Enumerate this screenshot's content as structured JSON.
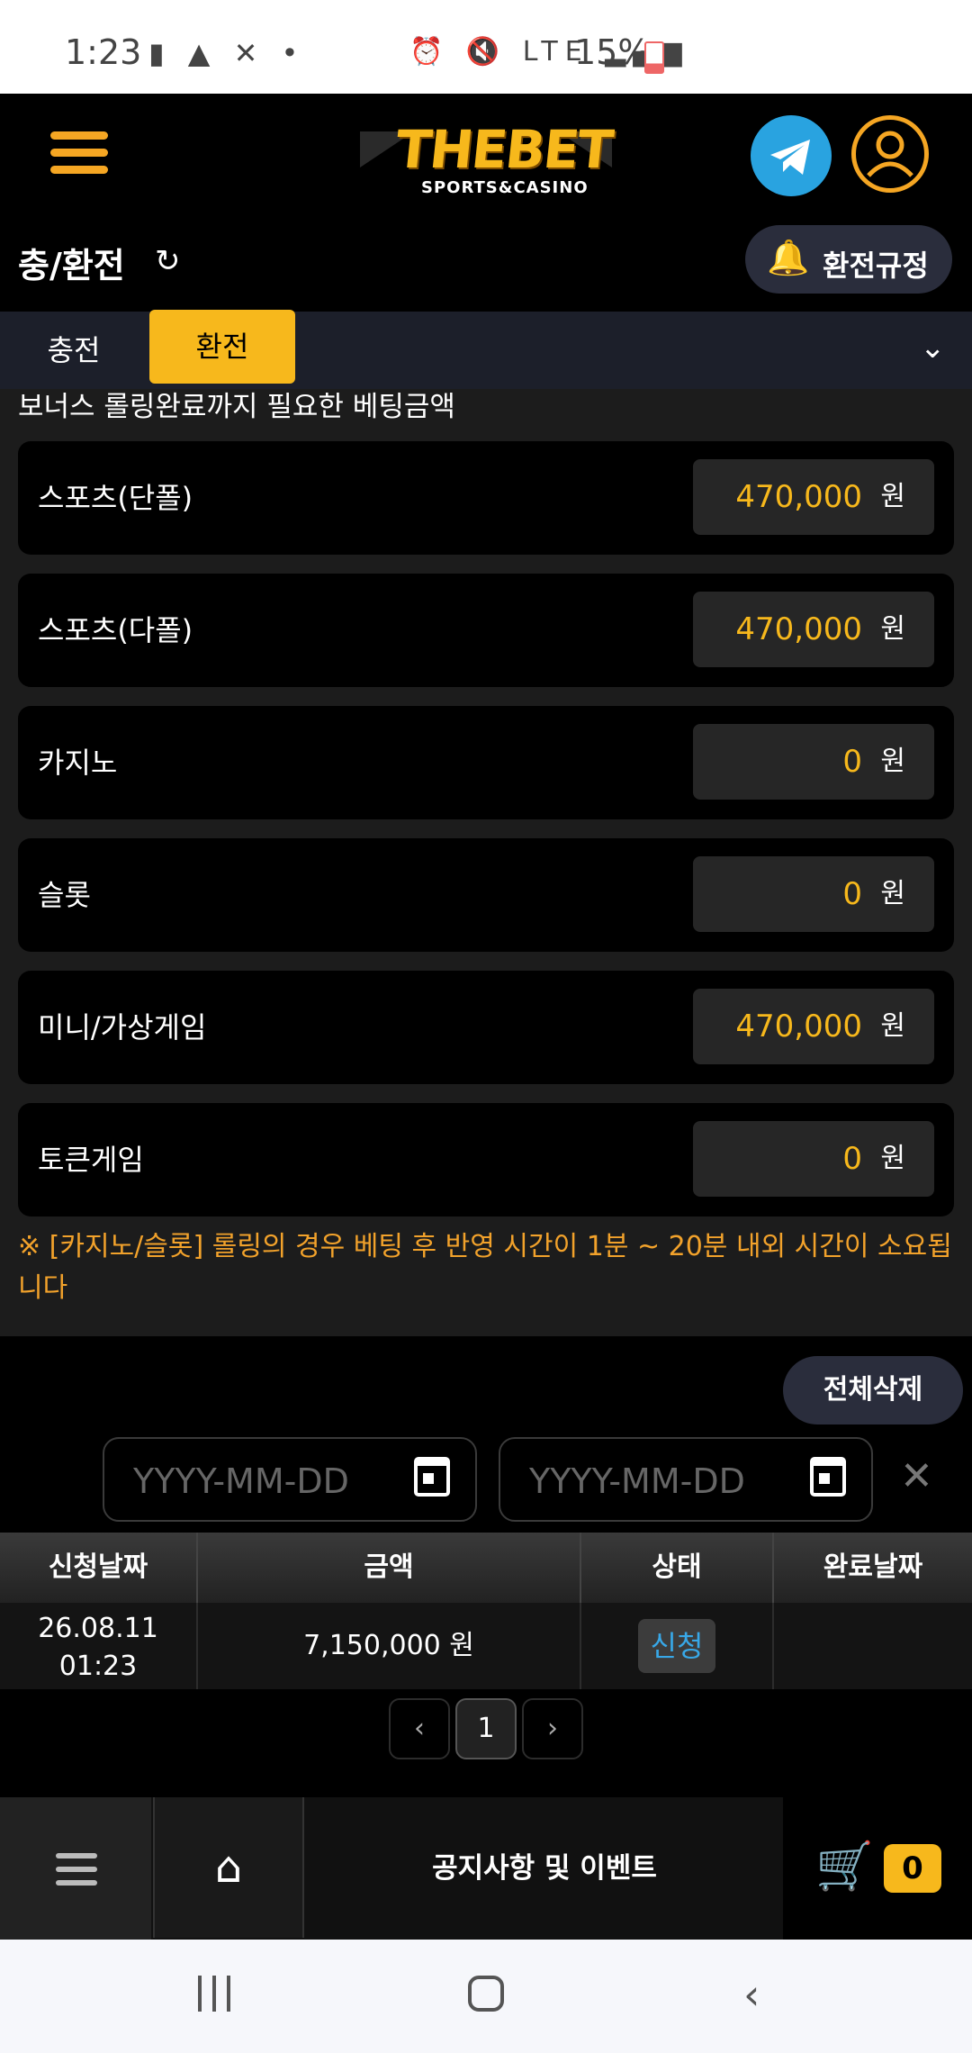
{
  "status_bar": {
    "time": "1:23",
    "left_icons": "▮ ▲ ✕ •",
    "right_icons": "⏰ 🔇 LTE ▂▄▆",
    "battery": "15%"
  },
  "header": {
    "logo_text": "THEBET",
    "logo_subtext": "SPORTS&CASINO",
    "icons": [
      "menu-icon",
      "telegram-icon",
      "profile-icon"
    ],
    "accent_color": "#f7b81c"
  },
  "title_row": {
    "title": "충/환전",
    "refresh_icon": "↻",
    "rules_button_icon": "🔔",
    "rules_button_label": "환전규정"
  },
  "tabs": {
    "items": [
      {
        "label": "충전",
        "active": false
      },
      {
        "label": "환전",
        "active": true
      }
    ],
    "chevron": "⌄"
  },
  "rolling": {
    "section_header": "보너스 롤링완료까지 필요한 베팅금액",
    "unit": "원",
    "rows": [
      {
        "label": "스포츠(단폴)",
        "value": "470,000"
      },
      {
        "label": "스포츠(다폴)",
        "value": "470,000"
      },
      {
        "label": "카지노",
        "value": "0"
      },
      {
        "label": "슬롯",
        "value": "0"
      },
      {
        "label": "미니/가상게임",
        "value": "470,000"
      },
      {
        "label": "토큰게임",
        "value": "0"
      }
    ],
    "note": "※ [카지노/슬롯] 롤링의 경우 베팅 후 반영 시간이 1분 ~ 20분 내외 시간이 소요됩니다"
  },
  "history": {
    "delete_all_label": "전체삭제",
    "date_from_placeholder": "YYYY-MM-DD",
    "date_to_placeholder": "YYYY-MM-DD",
    "clear_icon": "✕",
    "columns": [
      "신청날짜",
      "금액",
      "상태",
      "완료날짜"
    ],
    "rows": [
      {
        "request_date": "26.08.11",
        "request_time": "01:23",
        "amount": "7,150,000 원",
        "status": "신청",
        "complete_date": ""
      }
    ]
  },
  "pagination": {
    "prev": "‹",
    "current": "1",
    "next": "›"
  },
  "bottom_nav": {
    "home_icon": "⌂",
    "notice_label": "공지사항 및 이벤트",
    "cart_icon": "🛒",
    "cart_count": "0"
  }
}
